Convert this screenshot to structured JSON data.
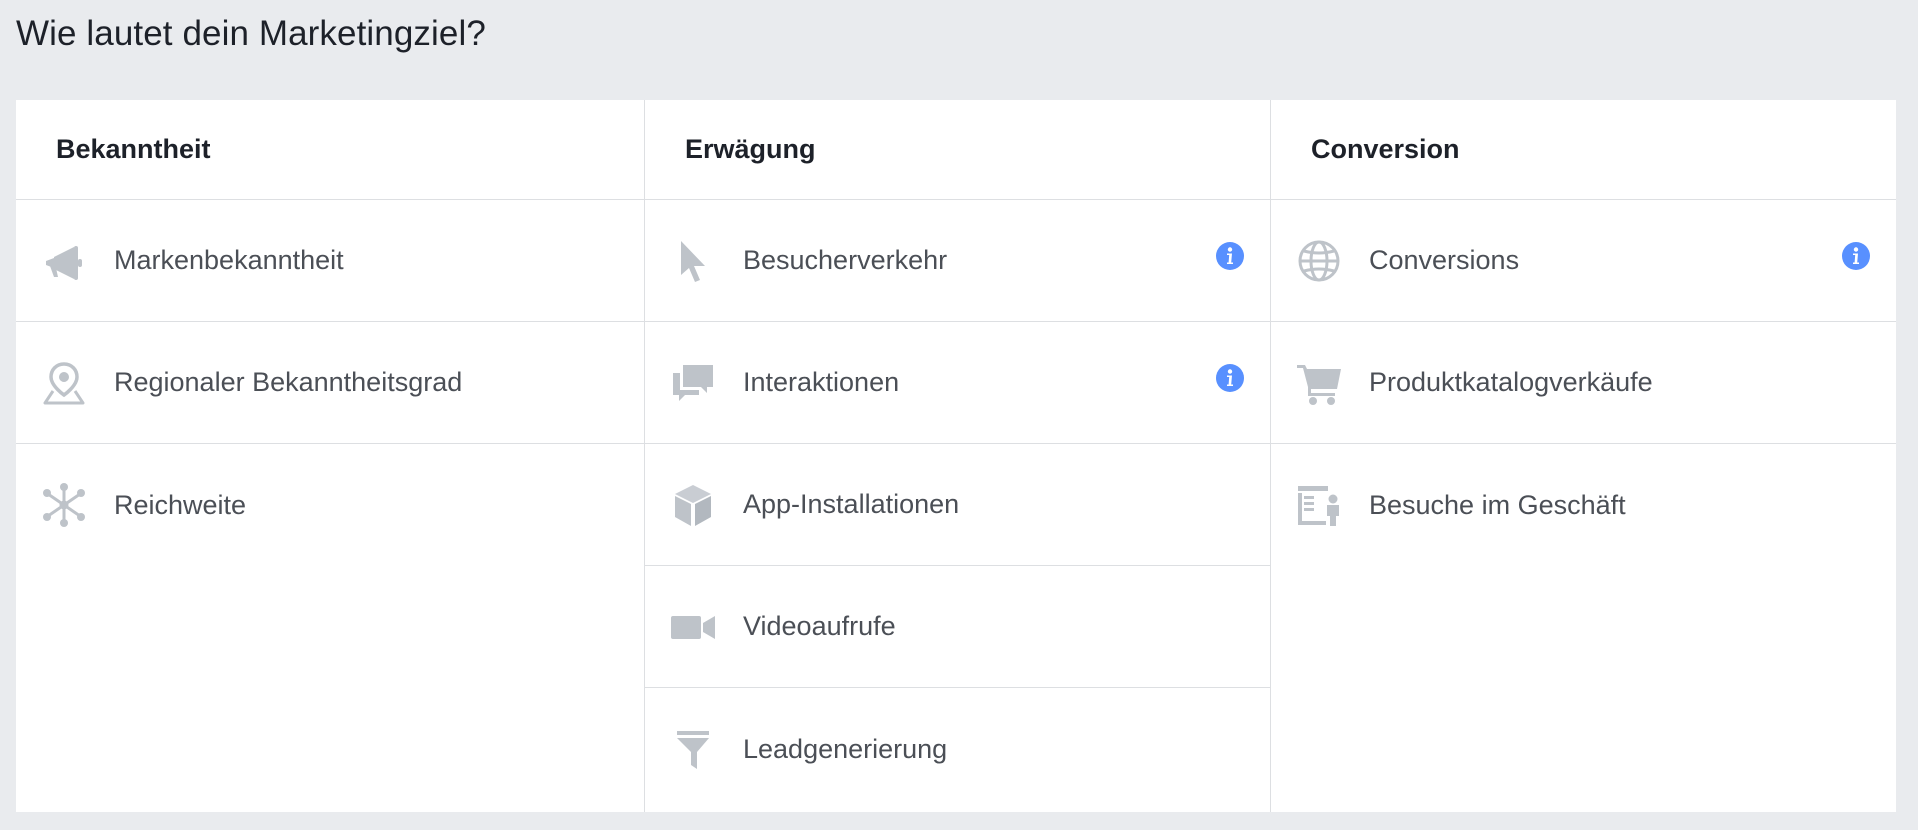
{
  "page": {
    "title": "Wie lautet dein Marketingziel?"
  },
  "colors": {
    "background": "#e9ebee",
    "panel": "#ffffff",
    "border": "#dddfe2",
    "icon": "#bec3c9",
    "info": "#5890ff",
    "text": "#4b4f56",
    "heading": "#1d2129"
  },
  "columns": [
    {
      "header": "Bekanntheit",
      "items": [
        {
          "label": "Markenbekanntheit",
          "icon": "megaphone-icon"
        },
        {
          "label": "Regionaler Bekanntheitsgrad",
          "icon": "map-pin-icon"
        },
        {
          "label": "Reichweite",
          "icon": "network-icon"
        }
      ]
    },
    {
      "header": "Erwägung",
      "items": [
        {
          "label": "Besucherverkehr",
          "icon": "cursor-icon",
          "info": "info-icon"
        },
        {
          "label": "Interaktionen",
          "icon": "chat-bubbles-icon",
          "info": "info-icon"
        },
        {
          "label": "App-Installationen",
          "icon": "cube-icon"
        },
        {
          "label": "Videoaufrufe",
          "icon": "video-camera-icon"
        },
        {
          "label": "Leadgenerierung",
          "icon": "funnel-icon"
        }
      ]
    },
    {
      "header": "Conversion",
      "items": [
        {
          "label": "Conversions",
          "icon": "globe-icon",
          "info": "info-icon"
        },
        {
          "label": "Produktkatalogverkäufe",
          "icon": "shopping-cart-icon"
        },
        {
          "label": "Besuche im Geschäft",
          "icon": "store-visitor-icon"
        }
      ]
    }
  ]
}
